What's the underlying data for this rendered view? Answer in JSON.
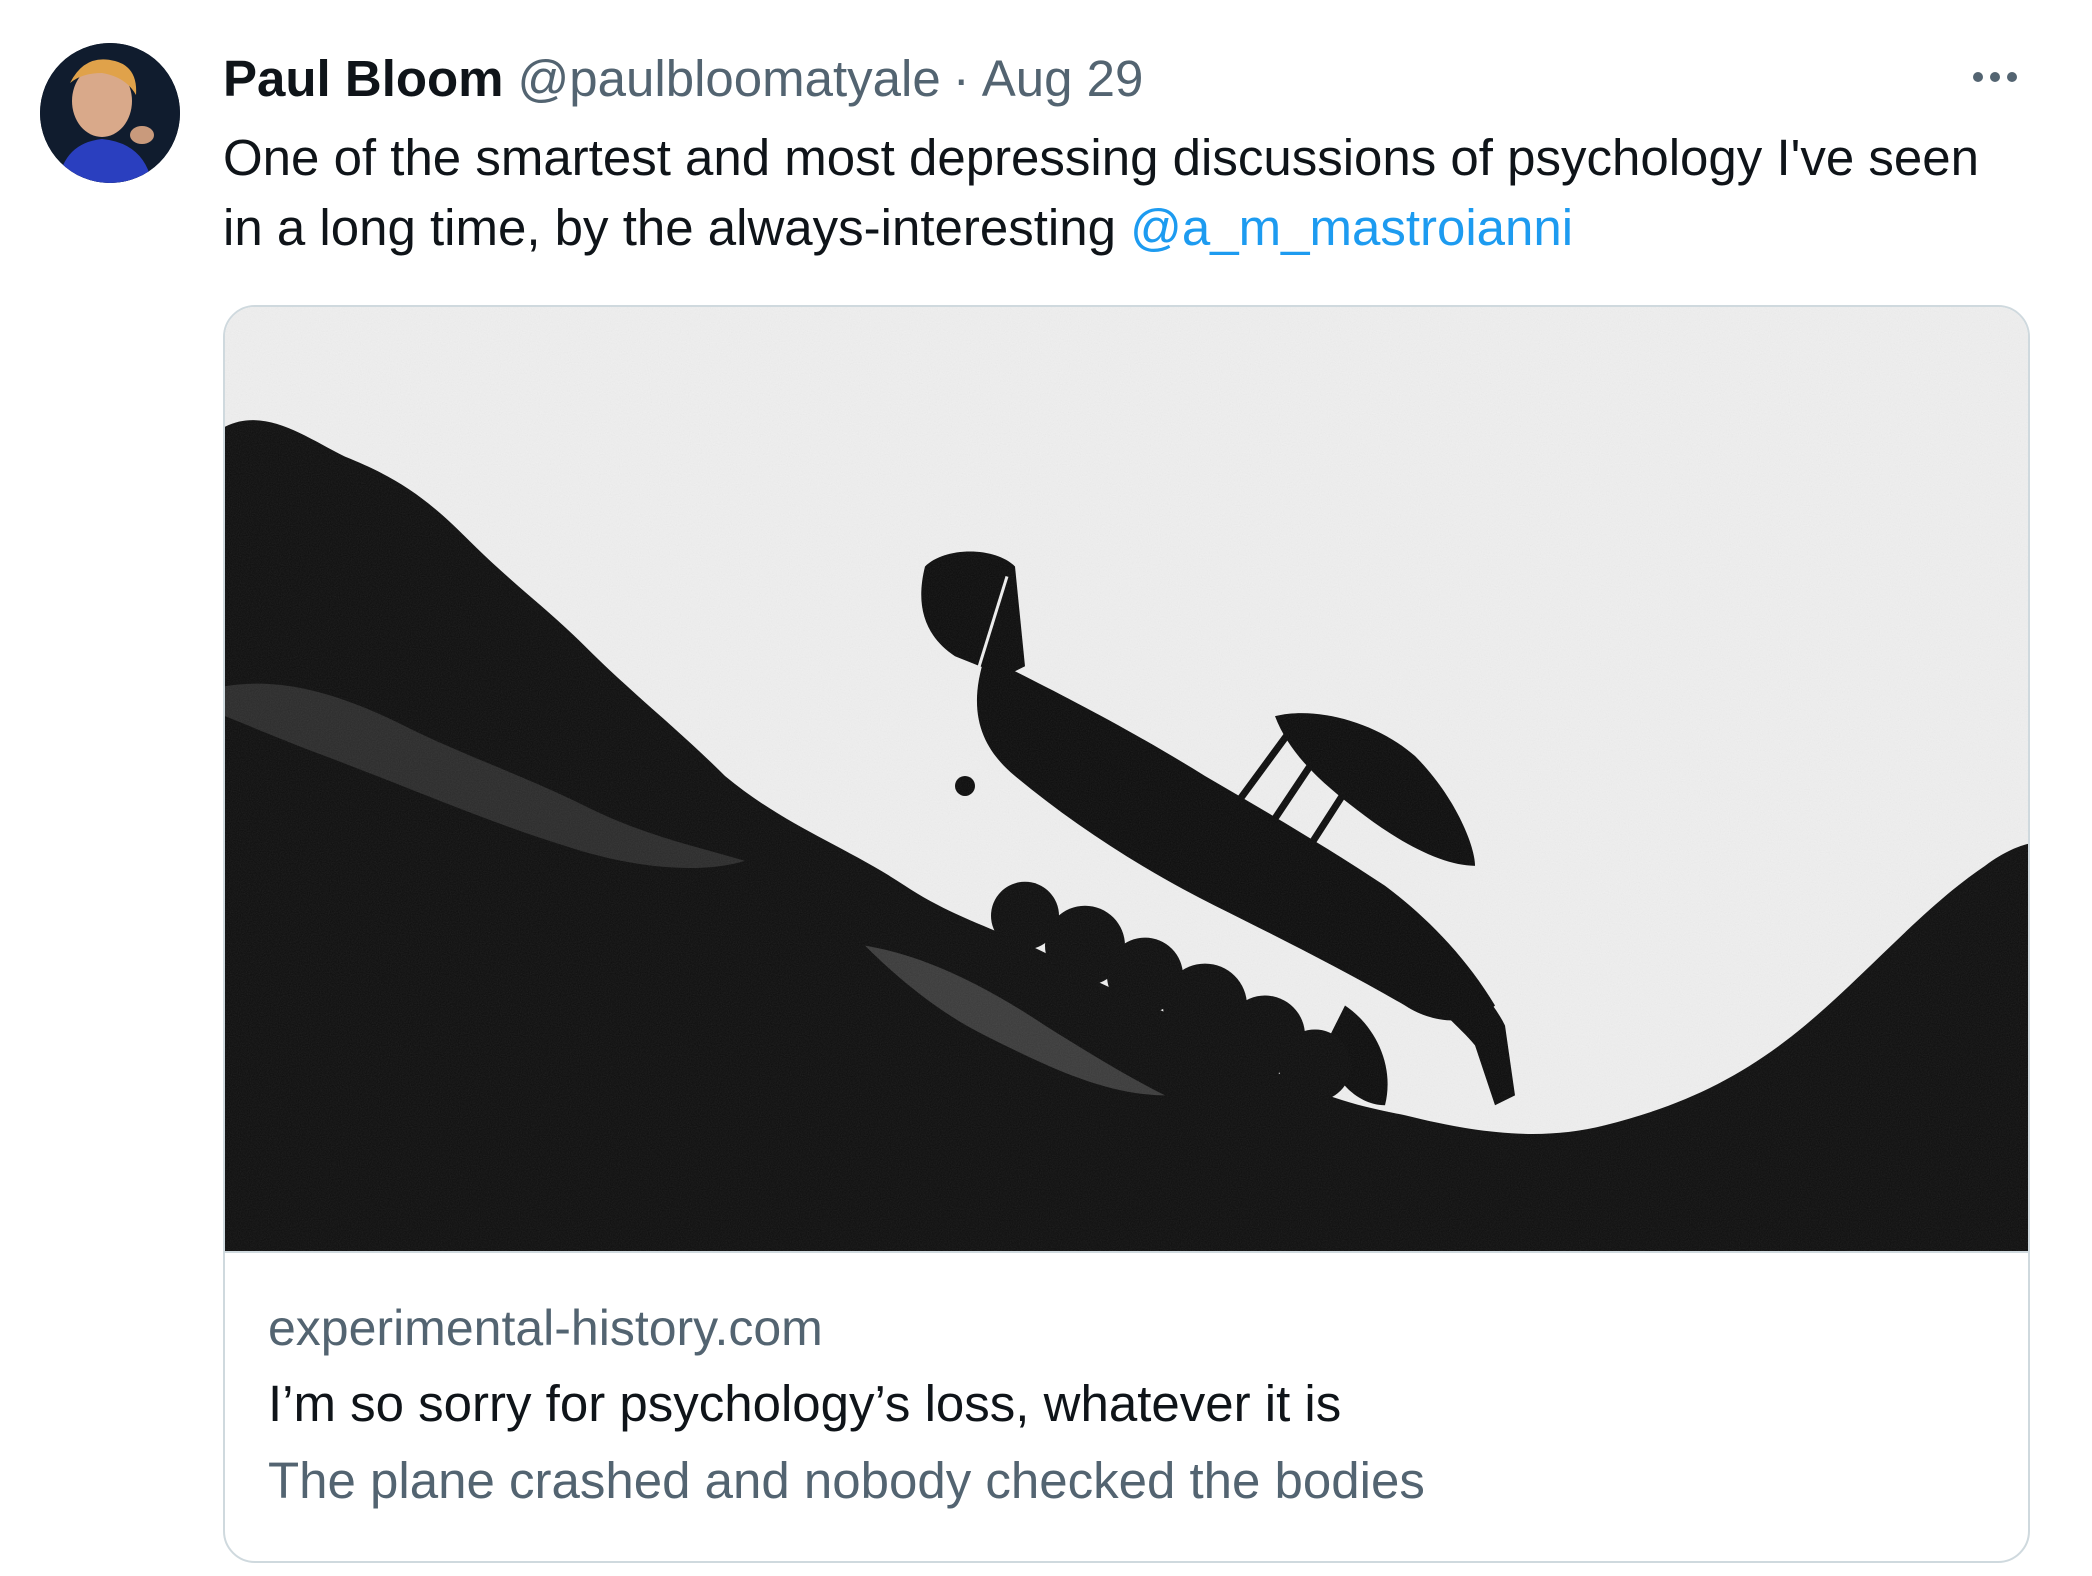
{
  "tweet": {
    "author_name": "Paul Bloom",
    "author_handle": "@paulbloomatyale",
    "separator": "·",
    "date": "Aug 29",
    "more_icon": "more-horizontal-icon",
    "text_before_mention": "One of the smartest and most depressing discussions of psychology I've seen in a long time, by the always-interesting ",
    "mention": "@a_m_mastroianni"
  },
  "card": {
    "domain": "experimental-history.com",
    "title": "I’m so sorry for psychology’s loss, whatever it is",
    "description": "The plane crashed and nobody checked the bodies"
  },
  "colors": {
    "text_primary": "#0f1419",
    "text_secondary": "#536471",
    "link": "#1d9bf0",
    "border": "#cfd9de"
  }
}
